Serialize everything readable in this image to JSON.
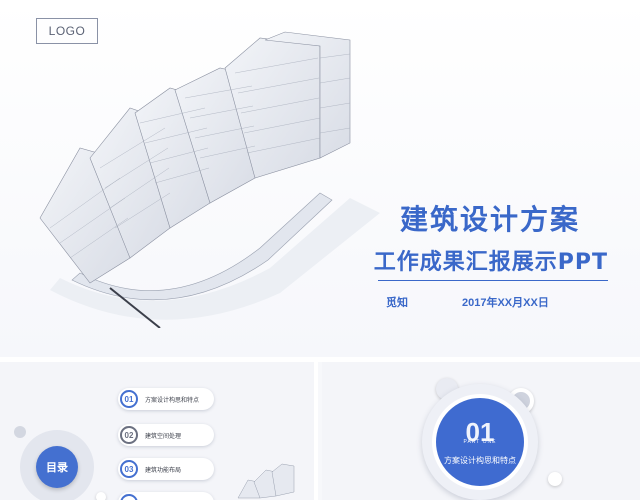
{
  "header": {
    "logo_text": "LOGO"
  },
  "cover": {
    "title_line1": "建筑设计方案",
    "title_line2": "工作成果汇报展示PPT",
    "author": "觅知",
    "date": "2017年XX月XX日"
  },
  "toc_slide": {
    "badge_label": "目录",
    "items": [
      {
        "num": "01",
        "label": "方案设计构思和特点"
      },
      {
        "num": "02",
        "label": "建筑空间处理"
      },
      {
        "num": "03",
        "label": "建筑功能布局"
      }
    ]
  },
  "part_slide": {
    "number": "01",
    "part_label": "PART ONE",
    "title": "方案设计构思和特点"
  },
  "colors": {
    "accent": "#3a68c9",
    "accent_dark": "#4470d0",
    "background": "#f7f8fb"
  }
}
